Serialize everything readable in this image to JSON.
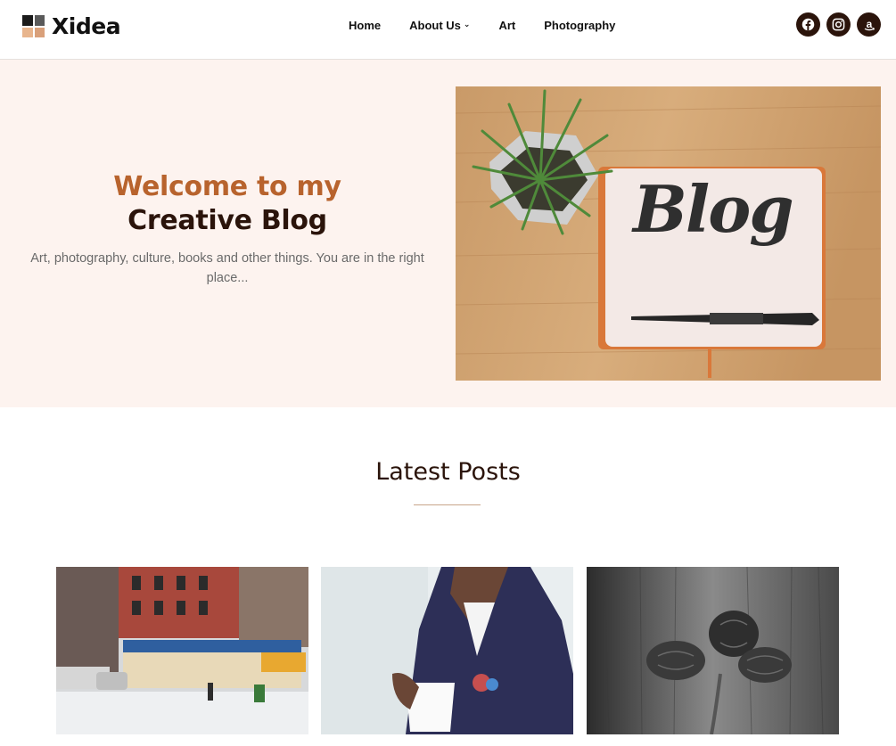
{
  "brand": {
    "name": "Xidea"
  },
  "nav": {
    "items": [
      {
        "label": "Home"
      },
      {
        "label": "About Us",
        "has_dropdown": true
      },
      {
        "label": "Art"
      },
      {
        "label": "Photography"
      }
    ]
  },
  "social": [
    "facebook-icon",
    "instagram-icon",
    "amazon-icon"
  ],
  "hero": {
    "title_line1": "Welcome to my",
    "title_line2": "Creative Blog",
    "subtitle": "Art, photography, culture, books and other things. You are in the right place...",
    "image_text": "Blog"
  },
  "latest": {
    "title": "Latest Posts"
  },
  "colors": {
    "accent": "#b8632d",
    "dark": "#2b140b",
    "hero_bg": "#fdf3ef"
  }
}
